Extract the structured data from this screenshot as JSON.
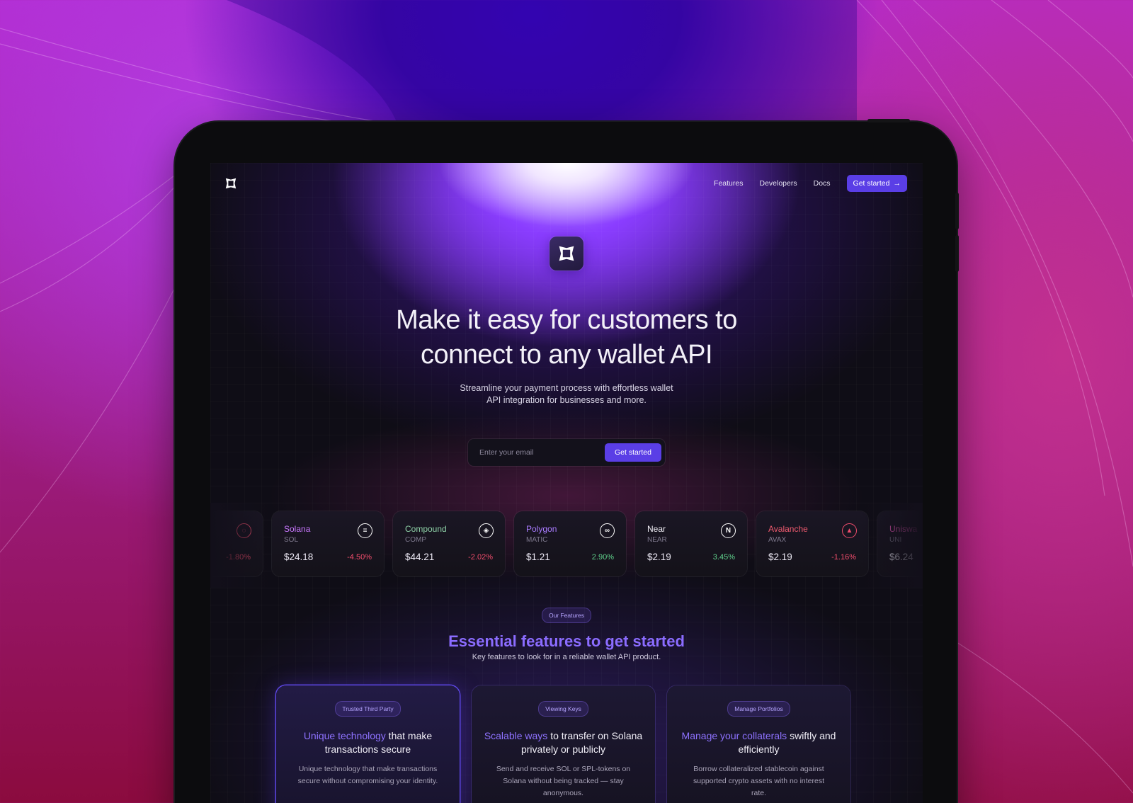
{
  "nav": {
    "links": [
      "Features",
      "Developers",
      "Docs"
    ],
    "cta_label": "Get started",
    "cta_arrow": "→"
  },
  "hero": {
    "title_line1": "Make it easy for customers to",
    "title_line2": "connect to any wallet API",
    "subtitle_line1": "Streamline your payment process with effortless wallet",
    "subtitle_line2": "API integration for businesses and more.",
    "email_placeholder": "Enter your email",
    "email_button": "Get started"
  },
  "tickers": [
    {
      "name": "",
      "symbol": "",
      "price": "",
      "change": "-1.80%",
      "trend": "down",
      "name_color": "#c58bff",
      "icon": "dots-ring-icon",
      "icon_color": "#ef4d6c"
    },
    {
      "name": "Solana",
      "symbol": "SOL",
      "price": "$24.18",
      "change": "-4.50%",
      "trend": "down",
      "name_color": "#c977ff",
      "icon": "solana-icon",
      "icon_color": "#ffffff"
    },
    {
      "name": "Compound",
      "symbol": "COMP",
      "price": "$44.21",
      "change": "-2.02%",
      "trend": "down",
      "name_color": "#8fd1a8",
      "icon": "compound-icon",
      "icon_color": "#ffffff"
    },
    {
      "name": "Polygon",
      "symbol": "MATIC",
      "price": "$1.21",
      "change": "2.90%",
      "trend": "up",
      "name_color": "#a97bff",
      "icon": "polygon-icon",
      "icon_color": "#ffffff"
    },
    {
      "name": "Near",
      "symbol": "NEAR",
      "price": "$2.19",
      "change": "3.45%",
      "trend": "up",
      "name_color": "#f2f0f7",
      "icon": "near-icon",
      "icon_color": "#ffffff"
    },
    {
      "name": "Avalanche",
      "symbol": "AVAX",
      "price": "$2.19",
      "change": "-1.16%",
      "trend": "down",
      "name_color": "#ef5a6f",
      "icon": "avalanche-icon",
      "icon_color": "#ef4d6c"
    },
    {
      "name": "Uniswa",
      "symbol": "UNI",
      "price": "$6.24",
      "change": "",
      "trend": "none",
      "name_color": "#ff5fc8",
      "icon": "uniswap-icon",
      "icon_color": "#ff5fc8"
    }
  ],
  "features": {
    "badge": "Our Features",
    "title": "Essential features to get started",
    "subtitle": "Key features to look for in a reliable wallet API product.",
    "cards": [
      {
        "badge": "Trusted Third Party",
        "title_hl": "Unique technology",
        "title_rest": " that make transactions secure",
        "desc": "Unique technology that make transactions secure without compromising your identity."
      },
      {
        "badge": "Viewing Keys",
        "title_hl": "Scalable ways",
        "title_rest": " to transfer on Solana privately or publicly",
        "desc": "Send and receive SOL or SPL-tokens on Solana without being tracked — stay anonymous."
      },
      {
        "badge": "Manage Portfolios",
        "title_hl": "Manage your collaterals",
        "title_rest": " swiftly and efficiently",
        "desc": "Borrow collateralized stablecoin against supported crypto assets with no interest rate."
      }
    ]
  }
}
